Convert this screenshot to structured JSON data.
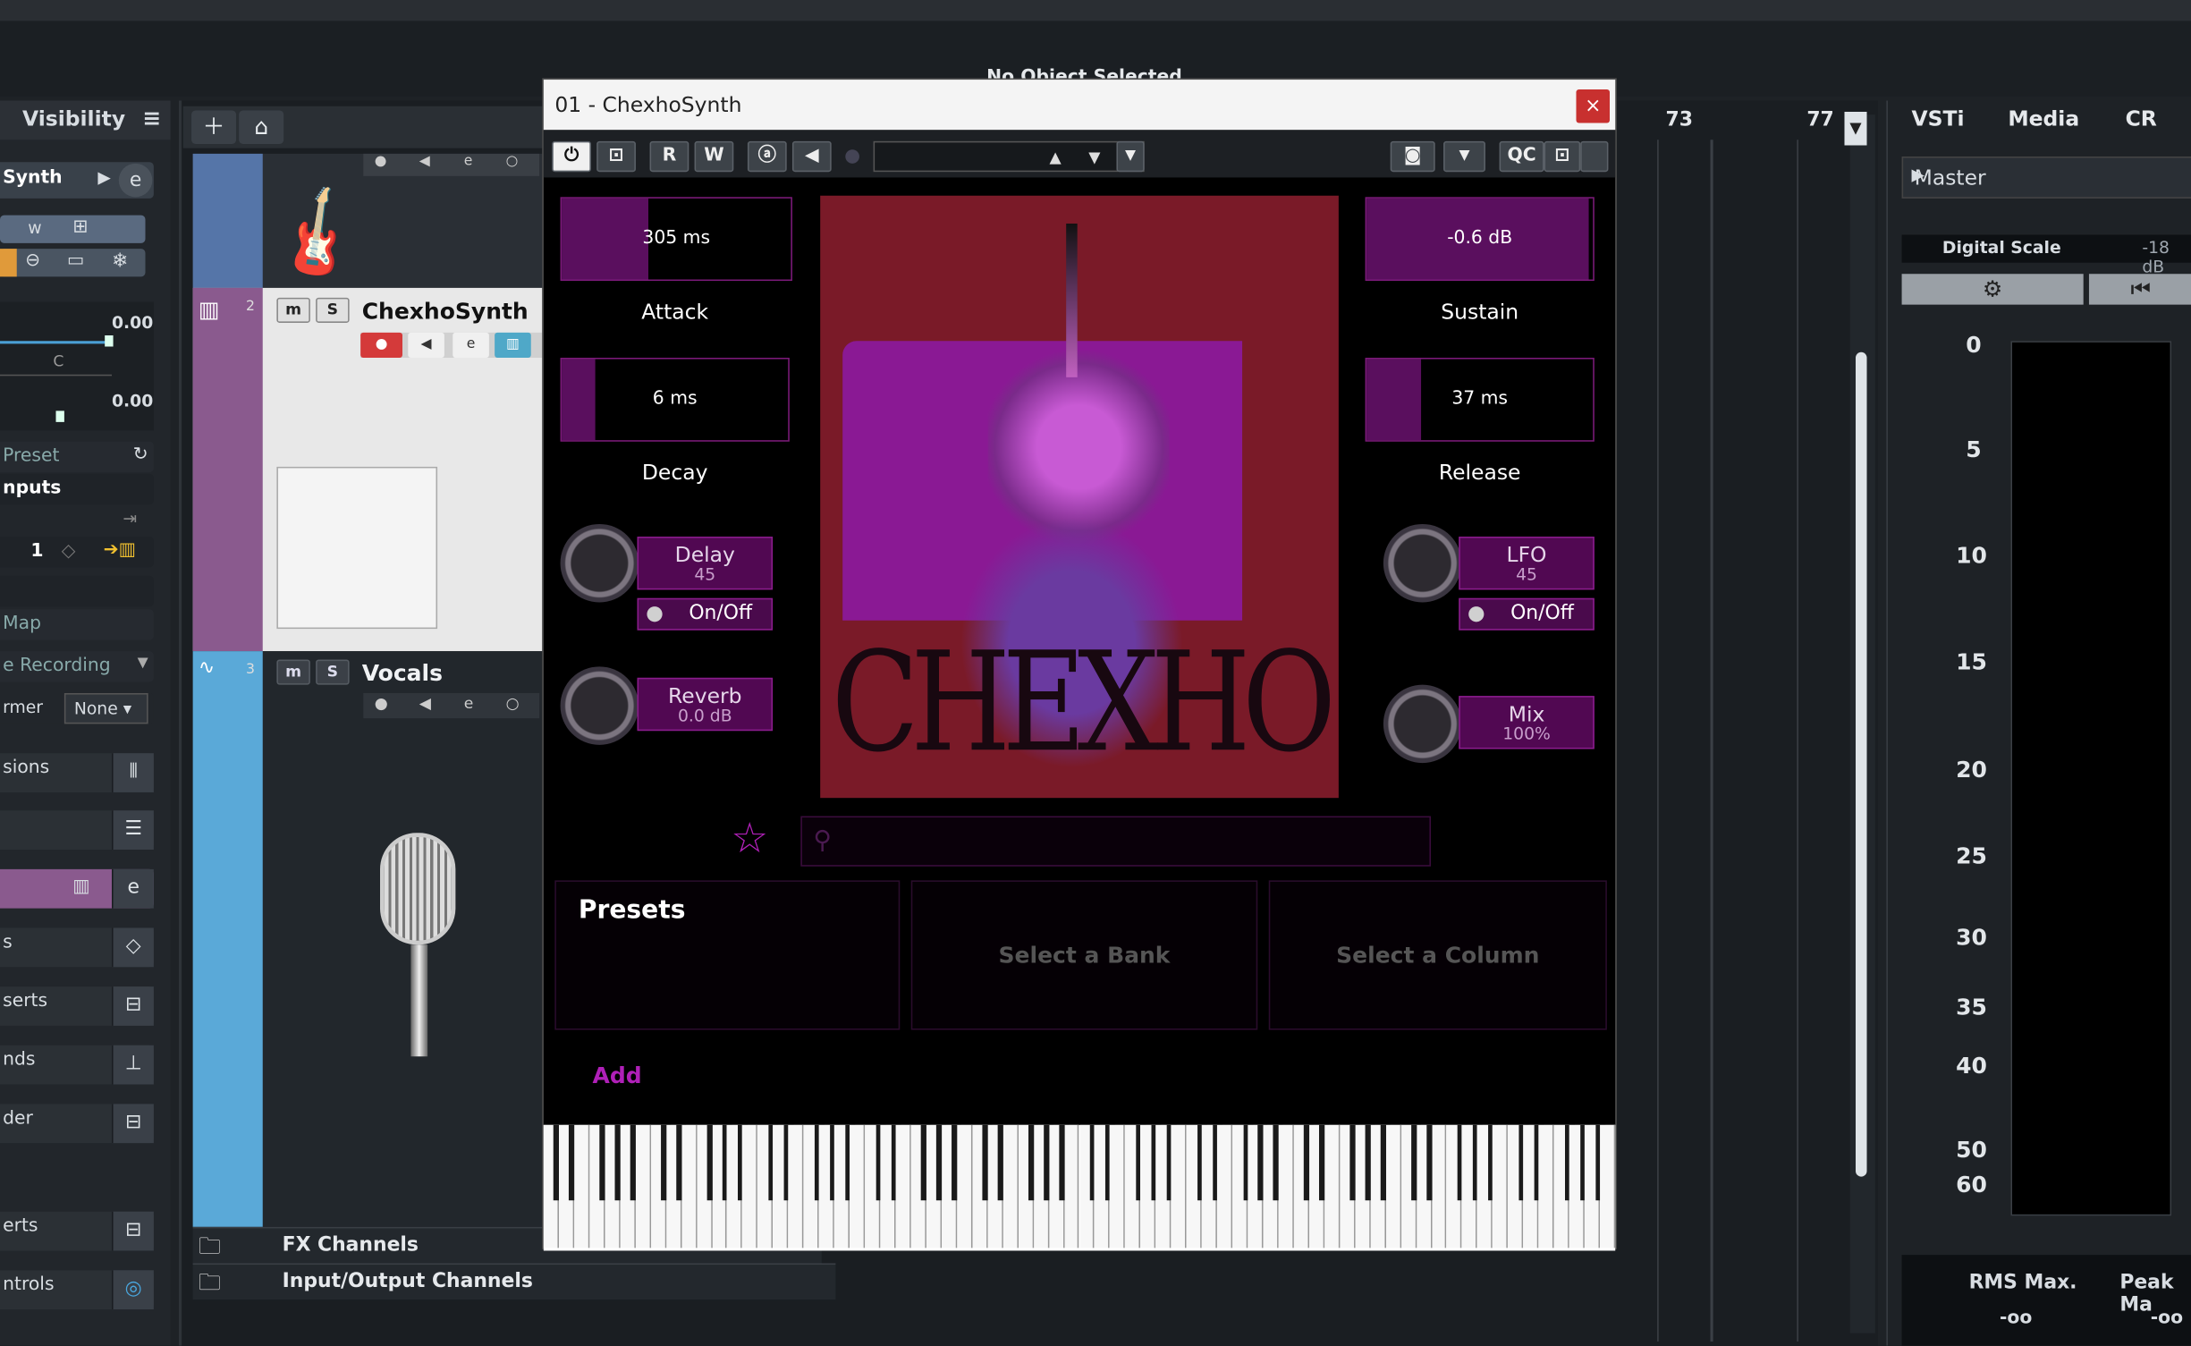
{
  "status": {
    "selection": "No Object Selected"
  },
  "inspector": {
    "header": "Visibility",
    "track_name": "Synth",
    "volume": "0.00",
    "pan_label": "C",
    "pan": "0.00",
    "preset_label": "Preset",
    "inputs_label": "nputs",
    "channel_num": "1",
    "map_label": "Map",
    "recording_label": "e Recording",
    "former_label": "rmer",
    "former_value": "None",
    "sections": [
      "sions",
      "",
      "",
      "s",
      "serts",
      "nds",
      "der",
      "erts",
      "ntrols"
    ]
  },
  "tracks": [
    {
      "number": "",
      "name": ""
    },
    {
      "number": "2",
      "name": "ChexhoSynth"
    },
    {
      "number": "3",
      "name": "Vocals"
    }
  ],
  "folders": {
    "fx": "FX Channels",
    "io": "Input/Output Channels"
  },
  "ruler": {
    "bar73": "73",
    "bar77": "77"
  },
  "right_panel": {
    "tabs": [
      "VSTi",
      "Media",
      "CR"
    ],
    "master": "Master",
    "scale_label": "Digital Scale",
    "scale_value": "-18 dB",
    "meter_ticks": [
      "0",
      "5",
      "10",
      "15",
      "20",
      "25",
      "30",
      "35",
      "40",
      "50",
      "60"
    ],
    "rms_label": "RMS Max.",
    "rms_value": "-oo",
    "peak_label": "Peak Ma",
    "peak_value": "-oo"
  },
  "plugin": {
    "title": "01 - ChexhoSynth",
    "close": "×",
    "toolbar": {
      "r": "R",
      "w": "W",
      "qc": "QC"
    },
    "attack": {
      "label": "Attack",
      "value": "305 ms",
      "level": 0.38
    },
    "decay": {
      "label": "Decay",
      "value": "6 ms",
      "level": 0.15
    },
    "sustain": {
      "label": "Sustain",
      "value": "-0.6 dB",
      "level": 0.98
    },
    "release": {
      "label": "Release",
      "value": "37 ms",
      "level": 0.24
    },
    "delay": {
      "label": "Delay",
      "value": "45",
      "toggle": "On/Off"
    },
    "reverb": {
      "label": "Reverb",
      "value": "0.0 dB"
    },
    "lfo": {
      "label": "LFO",
      "value": "45",
      "toggle": "On/Off"
    },
    "mix": {
      "label": "Mix",
      "value": "100%"
    },
    "artwork_text": "CHEXHO",
    "presets_title": "Presets",
    "bank_placeholder": "Select a Bank",
    "column_placeholder": "Select a Column",
    "add": "Add"
  },
  "colors": {
    "accent": "#8a1c8c",
    "artwork_bg": "#8a1a2a",
    "track_blue": "#5aa9d8",
    "track_purple": "#8a5a8e"
  }
}
